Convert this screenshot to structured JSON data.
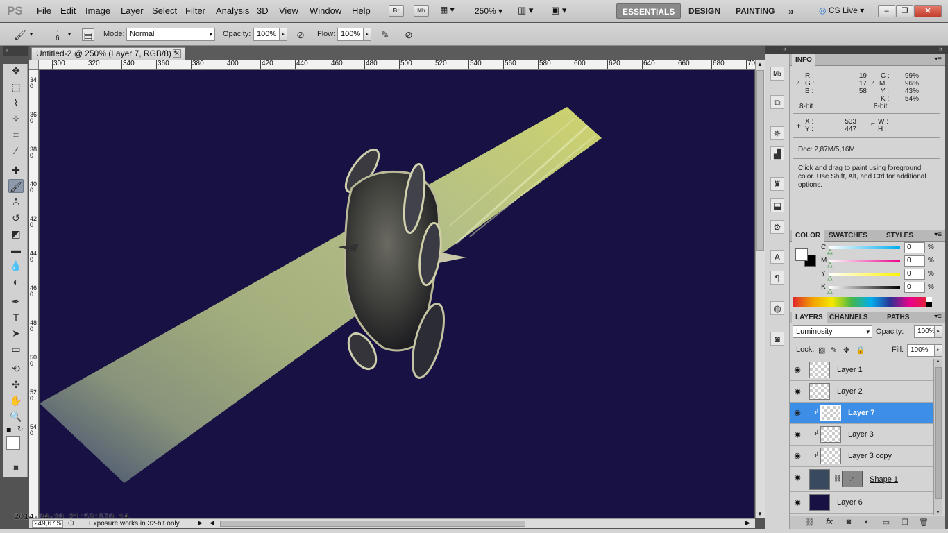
{
  "menu": {
    "logo": "PS",
    "items": [
      "File",
      "Edit",
      "Image",
      "Layer",
      "Select",
      "Filter",
      "Analysis",
      "3D",
      "View",
      "Window",
      "Help"
    ],
    "app_buttons": [
      "Br",
      "Mb"
    ],
    "zoom": "250%",
    "workspaces": [
      "ESSENTIALS",
      "DESIGN",
      "PAINTING"
    ],
    "more": "»",
    "cslive": "CS Live"
  },
  "options": {
    "brush_size": "6",
    "mode_label": "Mode:",
    "mode_value": "Normal",
    "opacity_label": "Opacity:",
    "opacity_value": "100%",
    "flow_label": "Flow:",
    "flow_value": "100%"
  },
  "document": {
    "tab_title": "Untitled-2 @ 250% (Layer 7, RGB/8) *",
    "zoom_status": "249,67%",
    "status_text": "Exposure works in 32-bit only"
  },
  "rulers": {
    "h_labels": [
      "300",
      "320",
      "340",
      "360",
      "380",
      "400",
      "420",
      "440",
      "460",
      "480",
      "500",
      "520",
      "540",
      "560",
      "580",
      "600",
      "620",
      "640",
      "660",
      "680",
      "70"
    ],
    "v_labels": [
      "340",
      "360",
      "380",
      "400",
      "420",
      "440",
      "460",
      "480",
      "500",
      "520",
      "540"
    ]
  },
  "timestamp": "2014-04-28 21:53:570.14",
  "info": {
    "tab": "INFO",
    "r_label": "R :",
    "r": "19",
    "g_label": "G :",
    "g": "17",
    "b_label": "B :",
    "b": "58",
    "bit_left": "8-bit",
    "c_label": "C :",
    "c": "99%",
    "m_label": "M :",
    "m": "96%",
    "y_label": "Y :",
    "y": "43%",
    "k_label": "K :",
    "k": "54%",
    "bit_right": "8-bit",
    "x_label": "X :",
    "x": "533",
    "yy_label": "Y :",
    "yy": "447",
    "w_label": "W :",
    "h_label": "H :",
    "doc": "Doc: 2,87M/5,16M",
    "hint": "Click and drag to paint using foreground color.  Use Shift, Alt, and Ctrl for additional options."
  },
  "color_panel": {
    "tabs": [
      "COLOR",
      "SWATCHES",
      "STYLES"
    ],
    "channels": [
      {
        "label": "C",
        "value": "0",
        "unit": "%"
      },
      {
        "label": "M",
        "value": "0",
        "unit": "%"
      },
      {
        "label": "Y",
        "value": "0",
        "unit": "%"
      },
      {
        "label": "K",
        "value": "0",
        "unit": "%"
      }
    ]
  },
  "layers_panel": {
    "tabs": [
      "LAYERS",
      "CHANNELS",
      "PATHS"
    ],
    "blend_mode": "Luminosity",
    "opacity_label": "Opacity:",
    "opacity_value": "100%",
    "lock_label": "Lock:",
    "fill_label": "Fill:",
    "fill_value": "100%",
    "layers": [
      {
        "name": "Layer 1"
      },
      {
        "name": "Layer 2"
      },
      {
        "name": "Layer 7"
      },
      {
        "name": "Layer 3"
      },
      {
        "name": "Layer 3 copy"
      },
      {
        "name": "Shape 1"
      },
      {
        "name": "Layer 6"
      }
    ]
  },
  "colors": {
    "canvas_bg": "#181244",
    "selection": "#3d8ee6",
    "beam": "#b8c484"
  }
}
